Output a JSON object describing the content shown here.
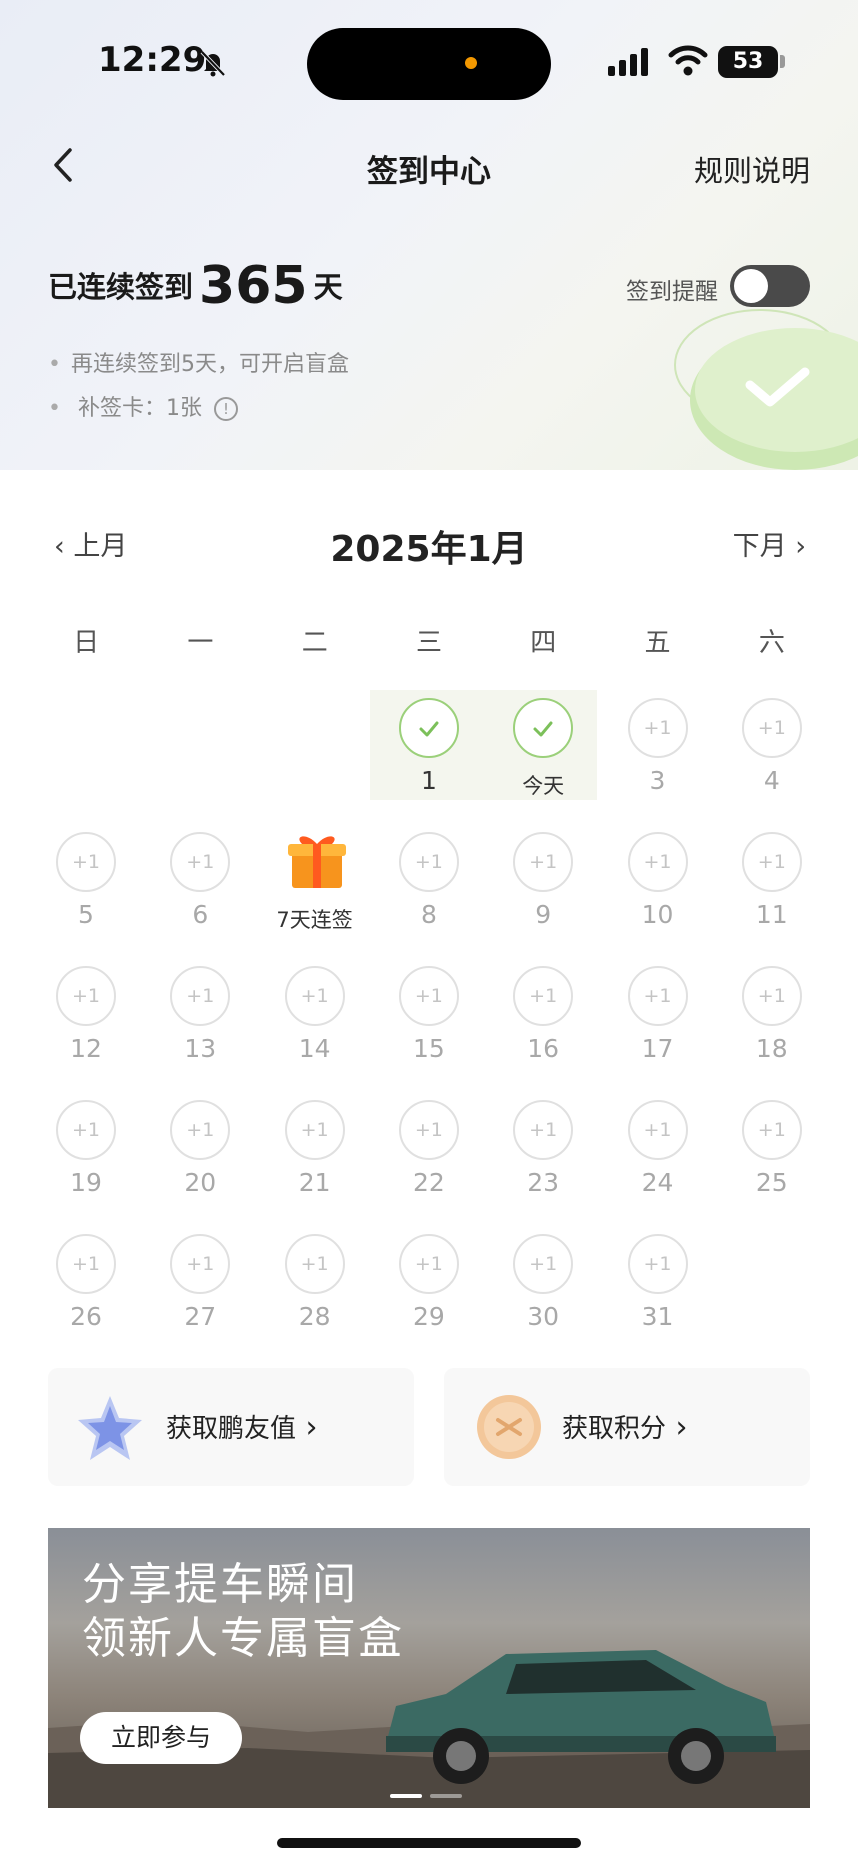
{
  "status_bar": {
    "time": "12:29",
    "battery": "53"
  },
  "nav": {
    "title": "签到中心",
    "rules": "规则说明"
  },
  "streak": {
    "prefix": "已连续签到",
    "days": "365",
    "suffix": "天"
  },
  "reminder": {
    "label": "签到提醒",
    "enabled": false
  },
  "bullets": {
    "blind_box": "再连续签到5天，可开启盲盒",
    "makeup_card": "补签卡：1张"
  },
  "calendar": {
    "title": "2025年1月",
    "prev": "上月",
    "next": "下月",
    "weekdays": [
      "日",
      "一",
      "二",
      "三",
      "四",
      "五",
      "六"
    ],
    "plus_label": "+1",
    "gift_label": "7天连签",
    "today_label": "今天",
    "days": [
      {
        "n": "1",
        "state": "done"
      },
      {
        "n": "今天",
        "state": "today"
      },
      {
        "n": "3",
        "state": "plus"
      },
      {
        "n": "4",
        "state": "plus"
      },
      {
        "n": "5",
        "state": "plus"
      },
      {
        "n": "6",
        "state": "plus"
      },
      {
        "n": "7天连签",
        "state": "gift"
      },
      {
        "n": "8",
        "state": "plus"
      },
      {
        "n": "9",
        "state": "plus"
      },
      {
        "n": "10",
        "state": "plus"
      },
      {
        "n": "11",
        "state": "plus"
      },
      {
        "n": "12",
        "state": "plus"
      },
      {
        "n": "13",
        "state": "plus"
      },
      {
        "n": "14",
        "state": "plus"
      },
      {
        "n": "15",
        "state": "plus"
      },
      {
        "n": "16",
        "state": "plus"
      },
      {
        "n": "17",
        "state": "plus"
      },
      {
        "n": "18",
        "state": "plus"
      },
      {
        "n": "19",
        "state": "plus"
      },
      {
        "n": "20",
        "state": "plus"
      },
      {
        "n": "21",
        "state": "plus"
      },
      {
        "n": "22",
        "state": "plus"
      },
      {
        "n": "23",
        "state": "plus"
      },
      {
        "n": "24",
        "state": "plus"
      },
      {
        "n": "25",
        "state": "plus"
      },
      {
        "n": "26",
        "state": "plus"
      },
      {
        "n": "27",
        "state": "plus"
      },
      {
        "n": "28",
        "state": "plus"
      },
      {
        "n": "29",
        "state": "plus"
      },
      {
        "n": "30",
        "state": "plus"
      },
      {
        "n": "31",
        "state": "plus"
      }
    ]
  },
  "rewards": {
    "friend_value": "获取鹏友值",
    "points": "获取积分"
  },
  "banner": {
    "line1": "分享提车瞬间",
    "line2": "领新人专属盲盒",
    "button": "立即参与"
  },
  "colors": {
    "accent_green": "#9bd07a",
    "toggle_off": "#4a4a4a"
  }
}
